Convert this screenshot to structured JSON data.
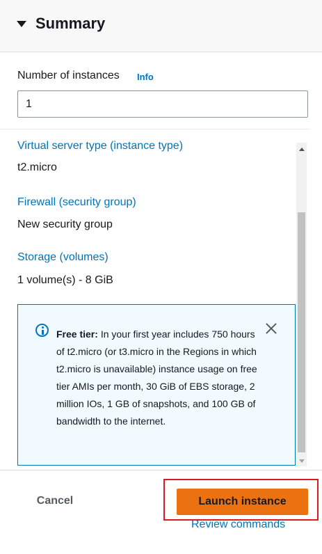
{
  "summary": {
    "title": "Summary",
    "caret_icon": "caret-down-icon"
  },
  "instances": {
    "label": "Number of instances",
    "info_label": "Info",
    "value": "1"
  },
  "details": [
    {
      "label": "Virtual server type (instance type)",
      "value": "t2.micro"
    },
    {
      "label": "Firewall (security group)",
      "value": "New security group"
    },
    {
      "label": "Storage (volumes)",
      "value": "1 volume(s) - 8 GiB"
    }
  ],
  "alert": {
    "icon": "info-circle-icon",
    "title": "Free tier:",
    "text": "In your first year includes 750 hours of t2.micro (or t3.micro in the Regions in which t2.micro is unavailable) instance usage on free tier AMIs per month, 30 GiB of EBS storage, 2 million IOs, 1 GB of snapshots, and 100 GB of bandwidth to the internet.",
    "close_icon": "close-icon"
  },
  "footer": {
    "cancel_label": "Cancel",
    "launch_label": "Launch instance",
    "review_label": "Review commands"
  },
  "colors": {
    "link": "#0073bb",
    "primary_button": "#ec7211",
    "highlight_box": "#e0181f",
    "alert_background": "#f1faff"
  }
}
